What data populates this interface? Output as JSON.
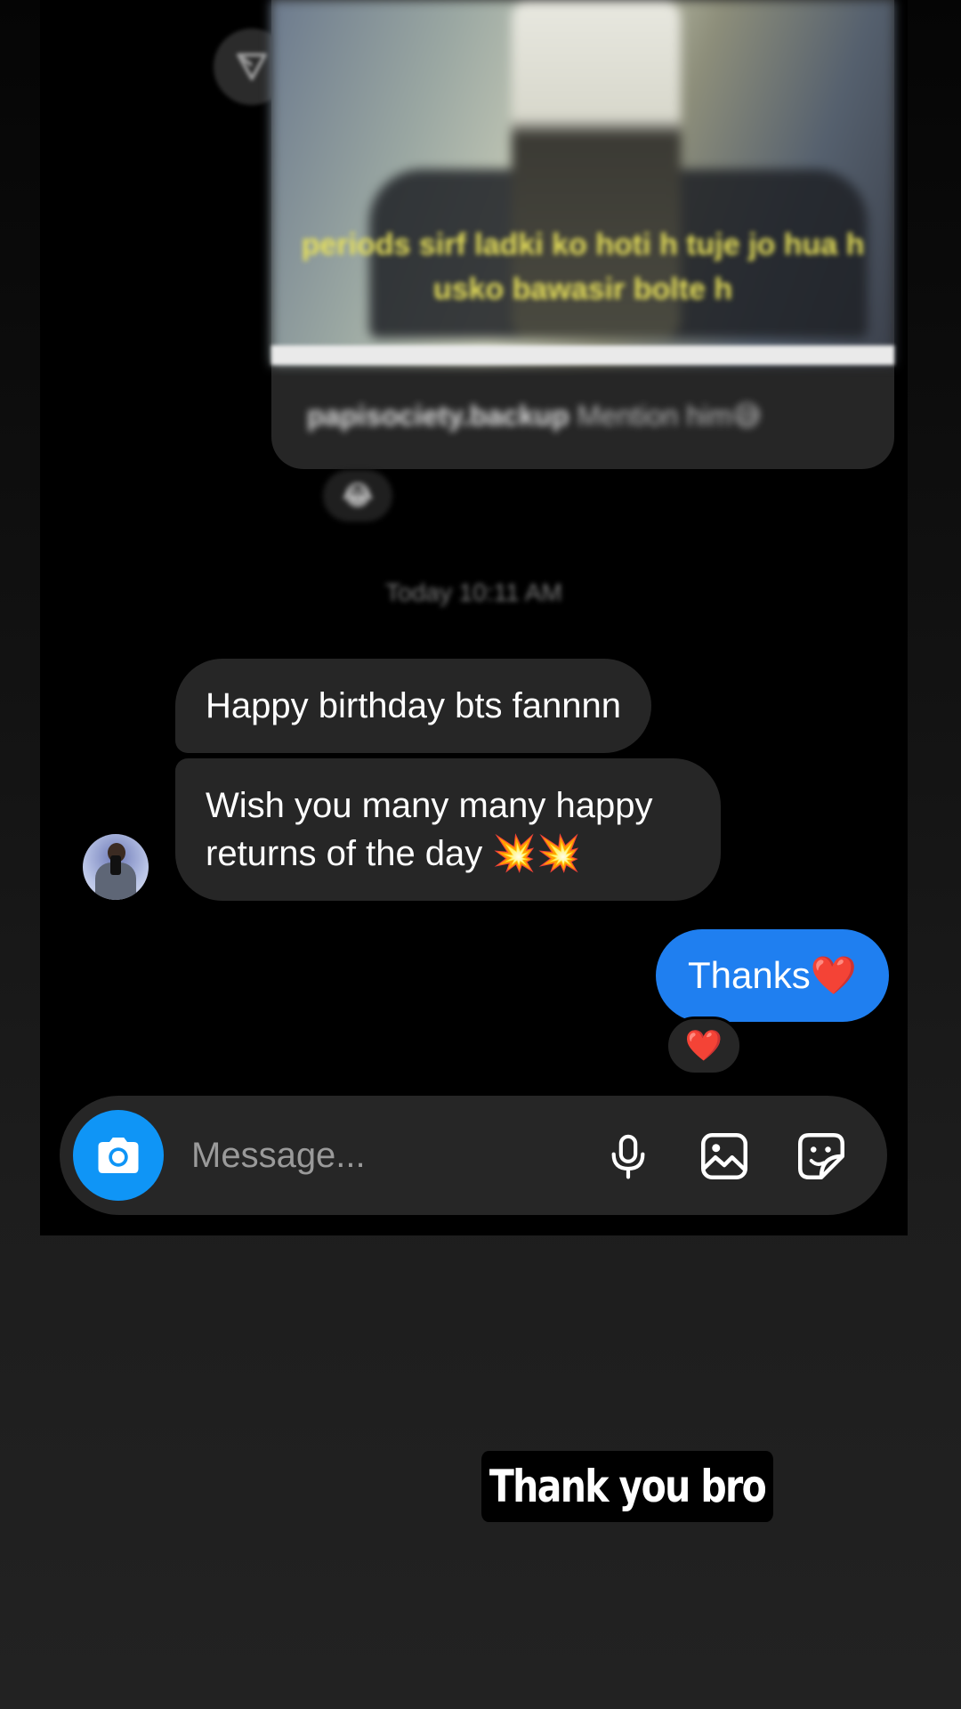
{
  "shared_post": {
    "caption_text": "periods sirf ladki ko hoti h tuje jo hua h usko bawasir bolte h",
    "account": "papisociety.backup",
    "message": "Mention him",
    "message_emoji": "😅",
    "reaction_emoji": "😂"
  },
  "timestamp": "Today 10:11 AM",
  "messages_received": [
    {
      "text": "Happy birthday bts fannnn"
    },
    {
      "text": "Wish you many many happy returns of the day 💥💥"
    }
  ],
  "message_sent": {
    "text": "Thanks",
    "emoji": "❤️"
  },
  "reaction_on_sent": "❤️",
  "composer": {
    "placeholder": "Message..."
  },
  "story_caption": "Thank you bro",
  "colors": {
    "sent_bubble": "#1f7ff0",
    "received_bubble": "#262626",
    "camera_button": "#0f95f6"
  },
  "icons": [
    "share-icon",
    "camera-icon",
    "microphone-icon",
    "gallery-icon",
    "sticker-icon"
  ]
}
